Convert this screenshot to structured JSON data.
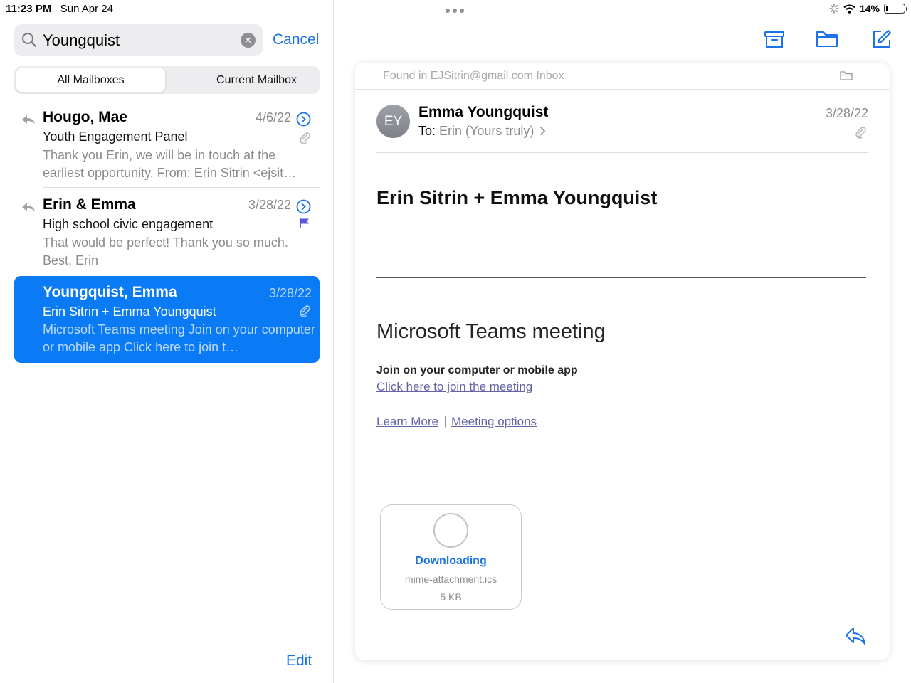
{
  "status_bar": {
    "time": "11:23 PM",
    "date": "Sun Apr 24",
    "battery": "14%",
    "battery_level": 0.14
  },
  "search": {
    "query": "Youngquist",
    "placeholder": "Search",
    "cancel_label": "Cancel"
  },
  "scope": {
    "all": "All Mailboxes",
    "current": "Current Mailbox",
    "selected": "all"
  },
  "messages": [
    {
      "sender": "Hougo, Mae",
      "date": "4/6/22",
      "subject": "Youth Engagement Panel",
      "preview": "Thank you Erin, we will be in touch at the earliest opportunity. From: Erin Sitrin <ejsit…",
      "replied": true,
      "attachment": true,
      "flagged": false
    },
    {
      "sender": "Erin & Emma",
      "date": "3/28/22",
      "subject": "High school civic engagement",
      "preview": "That would be perfect! Thank you so much. Best, Erin",
      "replied": true,
      "attachment": false,
      "flagged": true
    },
    {
      "sender": "Youngquist, Emma",
      "date": "3/28/22",
      "subject": "Erin Sitrin + Emma Youngquist",
      "preview": "Microsoft Teams meeting Join on your computer or mobile app Click here to join t…",
      "replied": false,
      "attachment": true,
      "flagged": false,
      "selected": true
    }
  ],
  "edit_label": "Edit",
  "toolbar_icons": [
    "archive-icon",
    "folder-icon",
    "compose-icon"
  ],
  "email": {
    "found_in": "Found in EJSitrin@gmail.com Inbox",
    "avatar_initials": "EY",
    "from": "Emma Youngquist",
    "to_label": "To:",
    "to_value": "Erin (Yours truly)",
    "date": "3/28/22",
    "title": "Erin Sitrin + Emma Youngquist",
    "meeting_heading": "Microsoft Teams meeting",
    "join_text": "Join on your computer or mobile app",
    "join_link": "Click here to join the meeting",
    "learn_more": "Learn More",
    "separator": "|",
    "meeting_options": "Meeting options",
    "attachment": {
      "status": "Downloading",
      "name": "mime-attachment.ics",
      "size": "5 KB"
    }
  },
  "colors": {
    "accent": "#1a73e8",
    "selected_row": "#0a7bf5",
    "teams_link": "#6264a7",
    "flag": "#5856d6"
  }
}
